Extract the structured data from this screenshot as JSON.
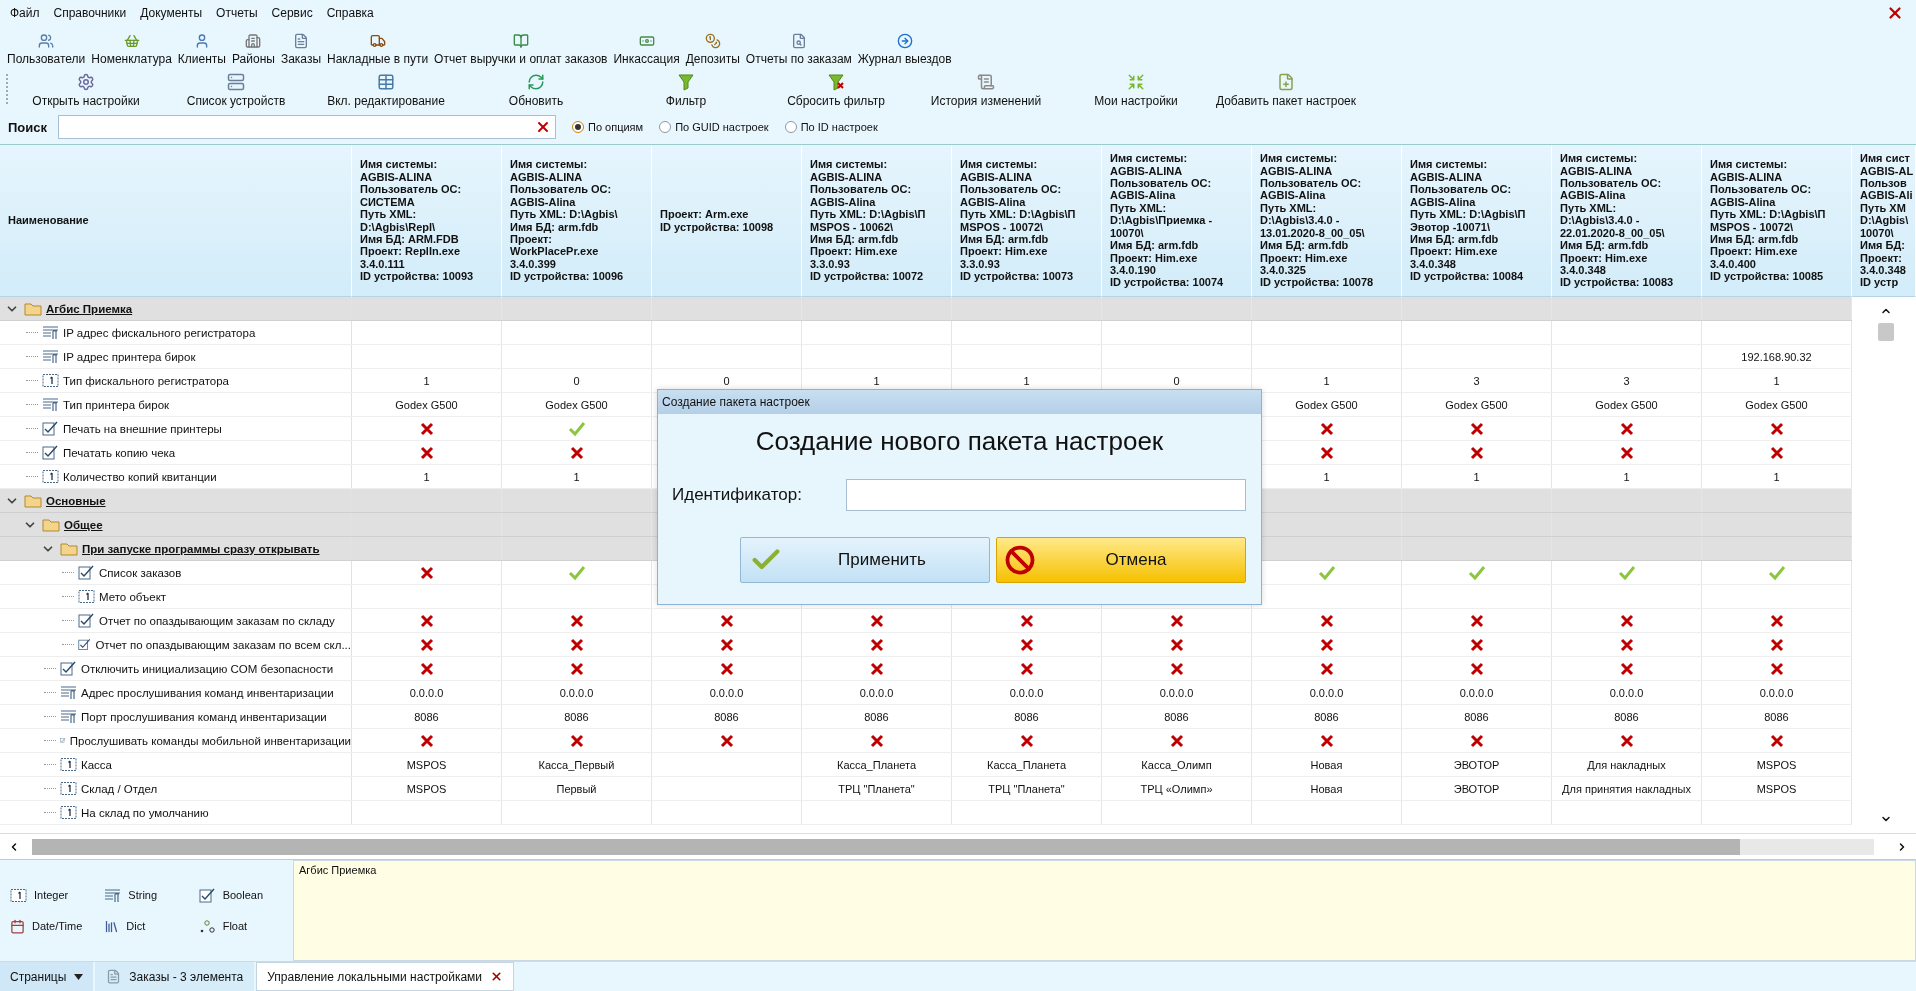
{
  "menu": [
    "Файл",
    "Справочники",
    "Документы",
    "Отчеты",
    "Сервис",
    "Справка"
  ],
  "toolbar": [
    "Пользователи",
    "Номенклатура",
    "Клиенты",
    "Районы",
    "Заказы",
    "Накладные в пути",
    "Отчет выручки и оплат заказов",
    "Инкассация",
    "Депозиты",
    "Отчеты по заказам",
    "Журнал выездов"
  ],
  "actions": [
    "Открыть настройки",
    "Список устройств",
    "Вкл. редактирование",
    "Обновить",
    "Фильтр",
    "Сбросить фильтр",
    "История изменений",
    "Мои настройки",
    "Добавить пакет настроек"
  ],
  "search": {
    "label": "Поиск"
  },
  "search_modes": [
    {
      "label": "По опциям",
      "selected": true
    },
    {
      "label": "По GUID настроек",
      "selected": false
    },
    {
      "label": "По ID настроек",
      "selected": false
    }
  ],
  "grid": {
    "name_column": "Наименование",
    "columns": [
      "Имя системы:\nAGBIS-ALINA\nПользователь ОС:\nСИСТЕМА\nПуть XML:\nD:\\Agbis\\Repl\\\nИмя БД: ARM.FDB\nПроект: ReplIn.exe\n3.4.0.111\nID устройства: 10093",
      "Имя системы:\nAGBIS-ALINA\nПользователь ОС:\nAGBIS-Alina\nПуть XML: D:\\Agbis\\\nИмя БД: arm.fdb\nПроект:\nWorkPlacePr.exe\n3.4.0.399\nID устройства: 10096",
      "Проект: Arm.exe\nID устройства: 10098",
      "Имя системы:\nAGBIS-ALINA\nПользователь ОС:\nAGBIS-Alina\nПуть XML: D:\\Agbis\\П\nMSPOS - 10062\\\nИмя БД: arm.fdb\nПроект: Him.exe\n3.3.0.93\nID устройства: 10072",
      "Имя системы:\nAGBIS-ALINA\nПользователь ОС:\nAGBIS-Alina\nПуть XML: D:\\Agbis\\П\nMSPOS - 10072\\\nИмя БД: arm.fdb\nПроект: Him.exe\n3.3.0.93\nID устройства: 10073",
      "Имя системы:\nAGBIS-ALINA\nПользователь ОС:\nAGBIS-Alina\nПуть XML:\nD:\\Agbis\\Приемка -\n10070\\\nИмя БД: arm.fdb\nПроект: Him.exe\n3.4.0.190\nID устройства: 10074",
      "Имя системы:\nAGBIS-ALINA\nПользователь ОС:\nAGBIS-Alina\nПуть XML:\nD:\\Agbis\\3.4.0 -\n13.01.2020-8_00_05\\\nИмя БД: arm.fdb\nПроект: Him.exe\n3.4.0.325\nID устройства: 10078",
      "Имя системы:\nAGBIS-ALINA\nПользователь ОС:\nAGBIS-Alina\nПуть XML: D:\\Agbis\\П\nЭвотор -10071\\\nИмя БД: arm.fdb\nПроект: Him.exe\n3.4.0.348\nID устройства: 10084",
      "Имя системы:\nAGBIS-ALINA\nПользователь ОС:\nAGBIS-Alina\nПуть XML:\nD:\\Agbis\\3.4.0 -\n22.01.2020-8_00_05\\\nИмя БД: arm.fdb\nПроект: Him.exe\n3.4.0.348\nID устройства: 10083",
      "Имя системы:\nAGBIS-ALINA\nПользователь ОС:\nAGBIS-Alina\nПуть XML: D:\\Agbis\\П\nMSPOS - 10072\\\nИмя БД: arm.fdb\nПроект: Him.exe\n3.4.0.400\nID устройства: 10085",
      "Имя сист\nAGBIS-AL\nПользов\nAGBIS-Ali\nПуть XM\nD:\\Agbis\\\n10070\\\nИмя БД:\nПроект:\n3.4.0.348\nID устр"
    ],
    "rows": [
      {
        "label": "Агбис Приемка",
        "kind": "folder",
        "expanded": true,
        "children": [
          {
            "label": "IP адрес фискального регистратора",
            "kind": "string",
            "cells": [
              null,
              null,
              null,
              null,
              null,
              null,
              null,
              null,
              null,
              null
            ]
          },
          {
            "label": "IP адрес принтера бирок",
            "kind": "string",
            "cells": [
              null,
              null,
              null,
              null,
              null,
              null,
              null,
              null,
              null,
              "192.168.90.32"
            ]
          },
          {
            "label": "Тип фискального регистратора",
            "kind": "integer",
            "cells": [
              "1",
              "0",
              "0",
              "1",
              "1",
              "0",
              "1",
              "3",
              "3",
              "1"
            ]
          },
          {
            "label": "Тип принтера бирок",
            "kind": "string",
            "cells": [
              "Godex G500",
              "Godex G500",
              null,
              null,
              null,
              null,
              "Godex G500",
              "Godex G500",
              "Godex G500",
              "Godex G500"
            ]
          },
          {
            "label": "Печать на внешние принтеры",
            "kind": "boolean",
            "cells": [
              {
                "checked": false
              },
              {
                "checked": true
              },
              null,
              null,
              null,
              null,
              {
                "checked": false
              },
              {
                "checked": false
              },
              {
                "checked": false
              },
              {
                "checked": false
              }
            ]
          },
          {
            "label": "Печатать копию чека",
            "kind": "boolean",
            "cells": [
              {
                "checked": false
              },
              {
                "checked": false
              },
              null,
              null,
              null,
              null,
              {
                "checked": false
              },
              {
                "checked": false
              },
              {
                "checked": false
              },
              {
                "checked": false
              }
            ]
          },
          {
            "label": "Количество копий квитанции",
            "kind": "integer",
            "cells": [
              "1",
              "1",
              null,
              null,
              null,
              null,
              "1",
              "1",
              "1",
              "1"
            ]
          }
        ]
      },
      {
        "label": "Основные",
        "kind": "folder",
        "expanded": true,
        "children": [
          {
            "label": "Общее",
            "kind": "folder",
            "expanded": true,
            "children": [
              {
                "label": "При запуске программы сразу открывать",
                "kind": "folder",
                "expanded": true,
                "children": [
                  {
                    "label": "Список заказов",
                    "kind": "boolean",
                    "cells": [
                      {
                        "checked": false
                      },
                      {
                        "checked": true
                      },
                      null,
                      null,
                      null,
                      null,
                      {
                        "checked": true
                      },
                      {
                        "checked": true
                      },
                      {
                        "checked": true
                      },
                      {
                        "checked": true
                      }
                    ]
                  },
                  {
                    "label": "Мето объект",
                    "kind": "integer",
                    "cells": [
                      null,
                      null,
                      null,
                      null,
                      null,
                      null,
                      null,
                      null,
                      null,
                      null
                    ]
                  },
                  {
                    "label": "Отчет по опаздывающим заказам по складу",
                    "kind": "boolean",
                    "cells": [
                      {
                        "checked": false
                      },
                      {
                        "checked": false
                      },
                      {
                        "checked": false
                      },
                      {
                        "checked": false
                      },
                      {
                        "checked": false
                      },
                      {
                        "checked": false
                      },
                      {
                        "checked": false
                      },
                      {
                        "checked": false
                      },
                      {
                        "checked": false
                      },
                      {
                        "checked": false
                      }
                    ]
                  },
                  {
                    "label": "Отчет по опаздывающим заказам по всем скл...",
                    "kind": "boolean",
                    "cells": [
                      {
                        "checked": false
                      },
                      {
                        "checked": false
                      },
                      {
                        "checked": false
                      },
                      {
                        "checked": false
                      },
                      {
                        "checked": false
                      },
                      {
                        "checked": false
                      },
                      {
                        "checked": false
                      },
                      {
                        "checked": false
                      },
                      {
                        "checked": false
                      },
                      {
                        "checked": false
                      }
                    ]
                  }
                ]
              },
              {
                "label": "Отключить инициализацию COM безопасности",
                "kind": "boolean",
                "cells": [
                  {
                    "checked": false
                  },
                  {
                    "checked": false
                  },
                  {
                    "checked": false
                  },
                  {
                    "checked": false
                  },
                  {
                    "checked": false
                  },
                  {
                    "checked": false
                  },
                  {
                    "checked": false
                  },
                  {
                    "checked": false
                  },
                  {
                    "checked": false
                  },
                  {
                    "checked": false
                  }
                ]
              },
              {
                "label": "Адрес прослушивания команд инвентаризации",
                "kind": "string",
                "cells": [
                  "0.0.0.0",
                  "0.0.0.0",
                  "0.0.0.0",
                  "0.0.0.0",
                  "0.0.0.0",
                  "0.0.0.0",
                  "0.0.0.0",
                  "0.0.0.0",
                  "0.0.0.0",
                  "0.0.0.0"
                ]
              },
              {
                "label": "Порт прослушивания команд инвентаризации",
                "kind": "string",
                "cells": [
                  "8086",
                  "8086",
                  "8086",
                  "8086",
                  "8086",
                  "8086",
                  "8086",
                  "8086",
                  "8086",
                  "8086"
                ]
              },
              {
                "label": "Прослушивать команды мобильной инвентаризации",
                "kind": "boolean",
                "cells": [
                  {
                    "checked": false
                  },
                  {
                    "checked": false
                  },
                  {
                    "checked": false
                  },
                  {
                    "checked": false
                  },
                  {
                    "checked": false
                  },
                  {
                    "checked": false
                  },
                  {
                    "checked": false
                  },
                  {
                    "checked": false
                  },
                  {
                    "checked": false
                  },
                  {
                    "checked": false
                  }
                ]
              },
              {
                "label": "Касса",
                "kind": "integer",
                "cells": [
                  "MSPOS",
                  "Касса_Первый",
                  null,
                  "Касса_Планета",
                  "Касса_Планета",
                  "Касса_Олимп",
                  "Новая",
                  "ЭВОТОР",
                  "Для накладных",
                  "MSPOS"
                ]
              },
              {
                "label": "Склад / Отдел",
                "kind": "integer",
                "cells": [
                  "MSPOS",
                  "Первый",
                  null,
                  "ТРЦ \"Планета\"",
                  "ТРЦ \"Планета\"",
                  "ТРЦ «Олимп»",
                  "Новая",
                  "ЭВОТОР",
                  "Для принятия накладных",
                  "MSPOS"
                ]
              },
              {
                "label": "На склад по умолчанию",
                "kind": "integer",
                "cells": [
                  null,
                  null,
                  null,
                  null,
                  null,
                  null,
                  null,
                  null,
                  null,
                  null
                ]
              }
            ]
          }
        ]
      }
    ]
  },
  "legend": [
    {
      "label": "Integer",
      "kind": "integer"
    },
    {
      "label": "String",
      "kind": "string"
    },
    {
      "label": "Boolean",
      "kind": "boolean"
    },
    {
      "label": "Date/Time",
      "kind": "datetime"
    },
    {
      "label": "Dict",
      "kind": "dict"
    },
    {
      "label": "Float",
      "kind": "float"
    }
  ],
  "description": "Агбис Приемка",
  "pages_button": "Страницы",
  "tabs": [
    {
      "label": "Заказы - 3 элемента",
      "selected": false
    },
    {
      "label": "Управление локальными настройками",
      "selected": true
    }
  ],
  "dialog": {
    "title": "Создание пакета настроек",
    "heading": "Создание нового пакета настроек",
    "field_label": "Идентификатор:",
    "buttons": [
      {
        "label": "Применить",
        "kind": "apply"
      },
      {
        "label": "Отмена",
        "kind": "cancel"
      }
    ]
  }
}
